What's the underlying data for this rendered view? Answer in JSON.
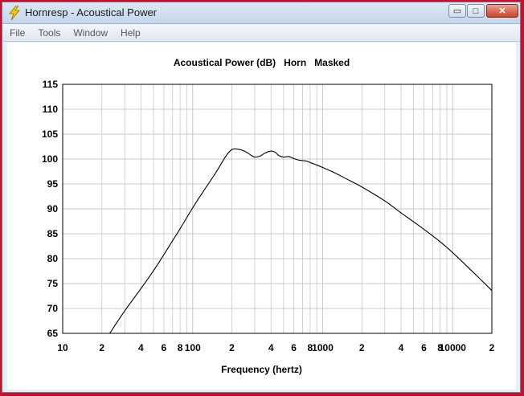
{
  "window": {
    "title": "Hornresp - Acoustical Power",
    "buttons": {
      "minimize": "▭",
      "maximize": "□",
      "close": "✕"
    }
  },
  "menu": {
    "items": [
      "File",
      "Tools",
      "Window",
      "Help"
    ]
  },
  "icons": {
    "app": "lightning-bolt-icon"
  },
  "colors": {
    "grid": "#c8c8c8",
    "curve": "#000000",
    "background": "#ffffff"
  },
  "chart_data": {
    "type": "line",
    "title": "Acoustical Power (dB)   Horn   Masked",
    "xlabel": "Frequency (hertz)",
    "ylabel": "",
    "xscale": "log",
    "xlim": [
      10,
      20000
    ],
    "ylim": [
      65,
      115
    ],
    "grid": true,
    "y_ticks": [
      65,
      70,
      75,
      80,
      85,
      90,
      95,
      100,
      105,
      110,
      115
    ],
    "x_ticks": [
      {
        "value": 10,
        "label": "10"
      },
      {
        "value": 20,
        "label": "2"
      },
      {
        "value": 40,
        "label": "4"
      },
      {
        "value": 60,
        "label": "6"
      },
      {
        "value": 80,
        "label": "8"
      },
      {
        "value": 100,
        "label": "100"
      },
      {
        "value": 200,
        "label": "2"
      },
      {
        "value": 400,
        "label": "4"
      },
      {
        "value": 600,
        "label": "6"
      },
      {
        "value": 800,
        "label": "8"
      },
      {
        "value": 1000,
        "label": "1000"
      },
      {
        "value": 2000,
        "label": "2"
      },
      {
        "value": 4000,
        "label": "4"
      },
      {
        "value": 6000,
        "label": "6"
      },
      {
        "value": 8000,
        "label": "8"
      },
      {
        "value": 10000,
        "label": "10000"
      },
      {
        "value": 20000,
        "label": "2"
      }
    ],
    "series": [
      {
        "x": [
          23,
          30,
          40,
          50,
          60,
          70,
          80,
          100,
          120,
          150,
          180,
          200,
          220,
          250,
          280,
          300,
          330,
          360,
          400,
          430,
          460,
          500,
          550,
          600,
          650,
          700,
          750,
          800,
          900,
          1000,
          1200,
          1500,
          2000,
          3000,
          4000,
          6000,
          8000,
          10000,
          15000,
          20000
        ],
        "y": [
          65,
          69.5,
          74,
          77.6,
          80.8,
          83.6,
          86,
          90.2,
          93.4,
          97.2,
          100.6,
          101.9,
          102.0,
          101.6,
          100.8,
          100.4,
          100.6,
          101.2,
          101.6,
          101.4,
          100.7,
          100.4,
          100.5,
          100.1,
          99.8,
          99.7,
          99.6,
          99.3,
          98.8,
          98.3,
          97.4,
          96.1,
          94.4,
          91.6,
          89.2,
          85.9,
          83.4,
          81.2,
          76.8,
          73.6
        ]
      }
    ]
  }
}
